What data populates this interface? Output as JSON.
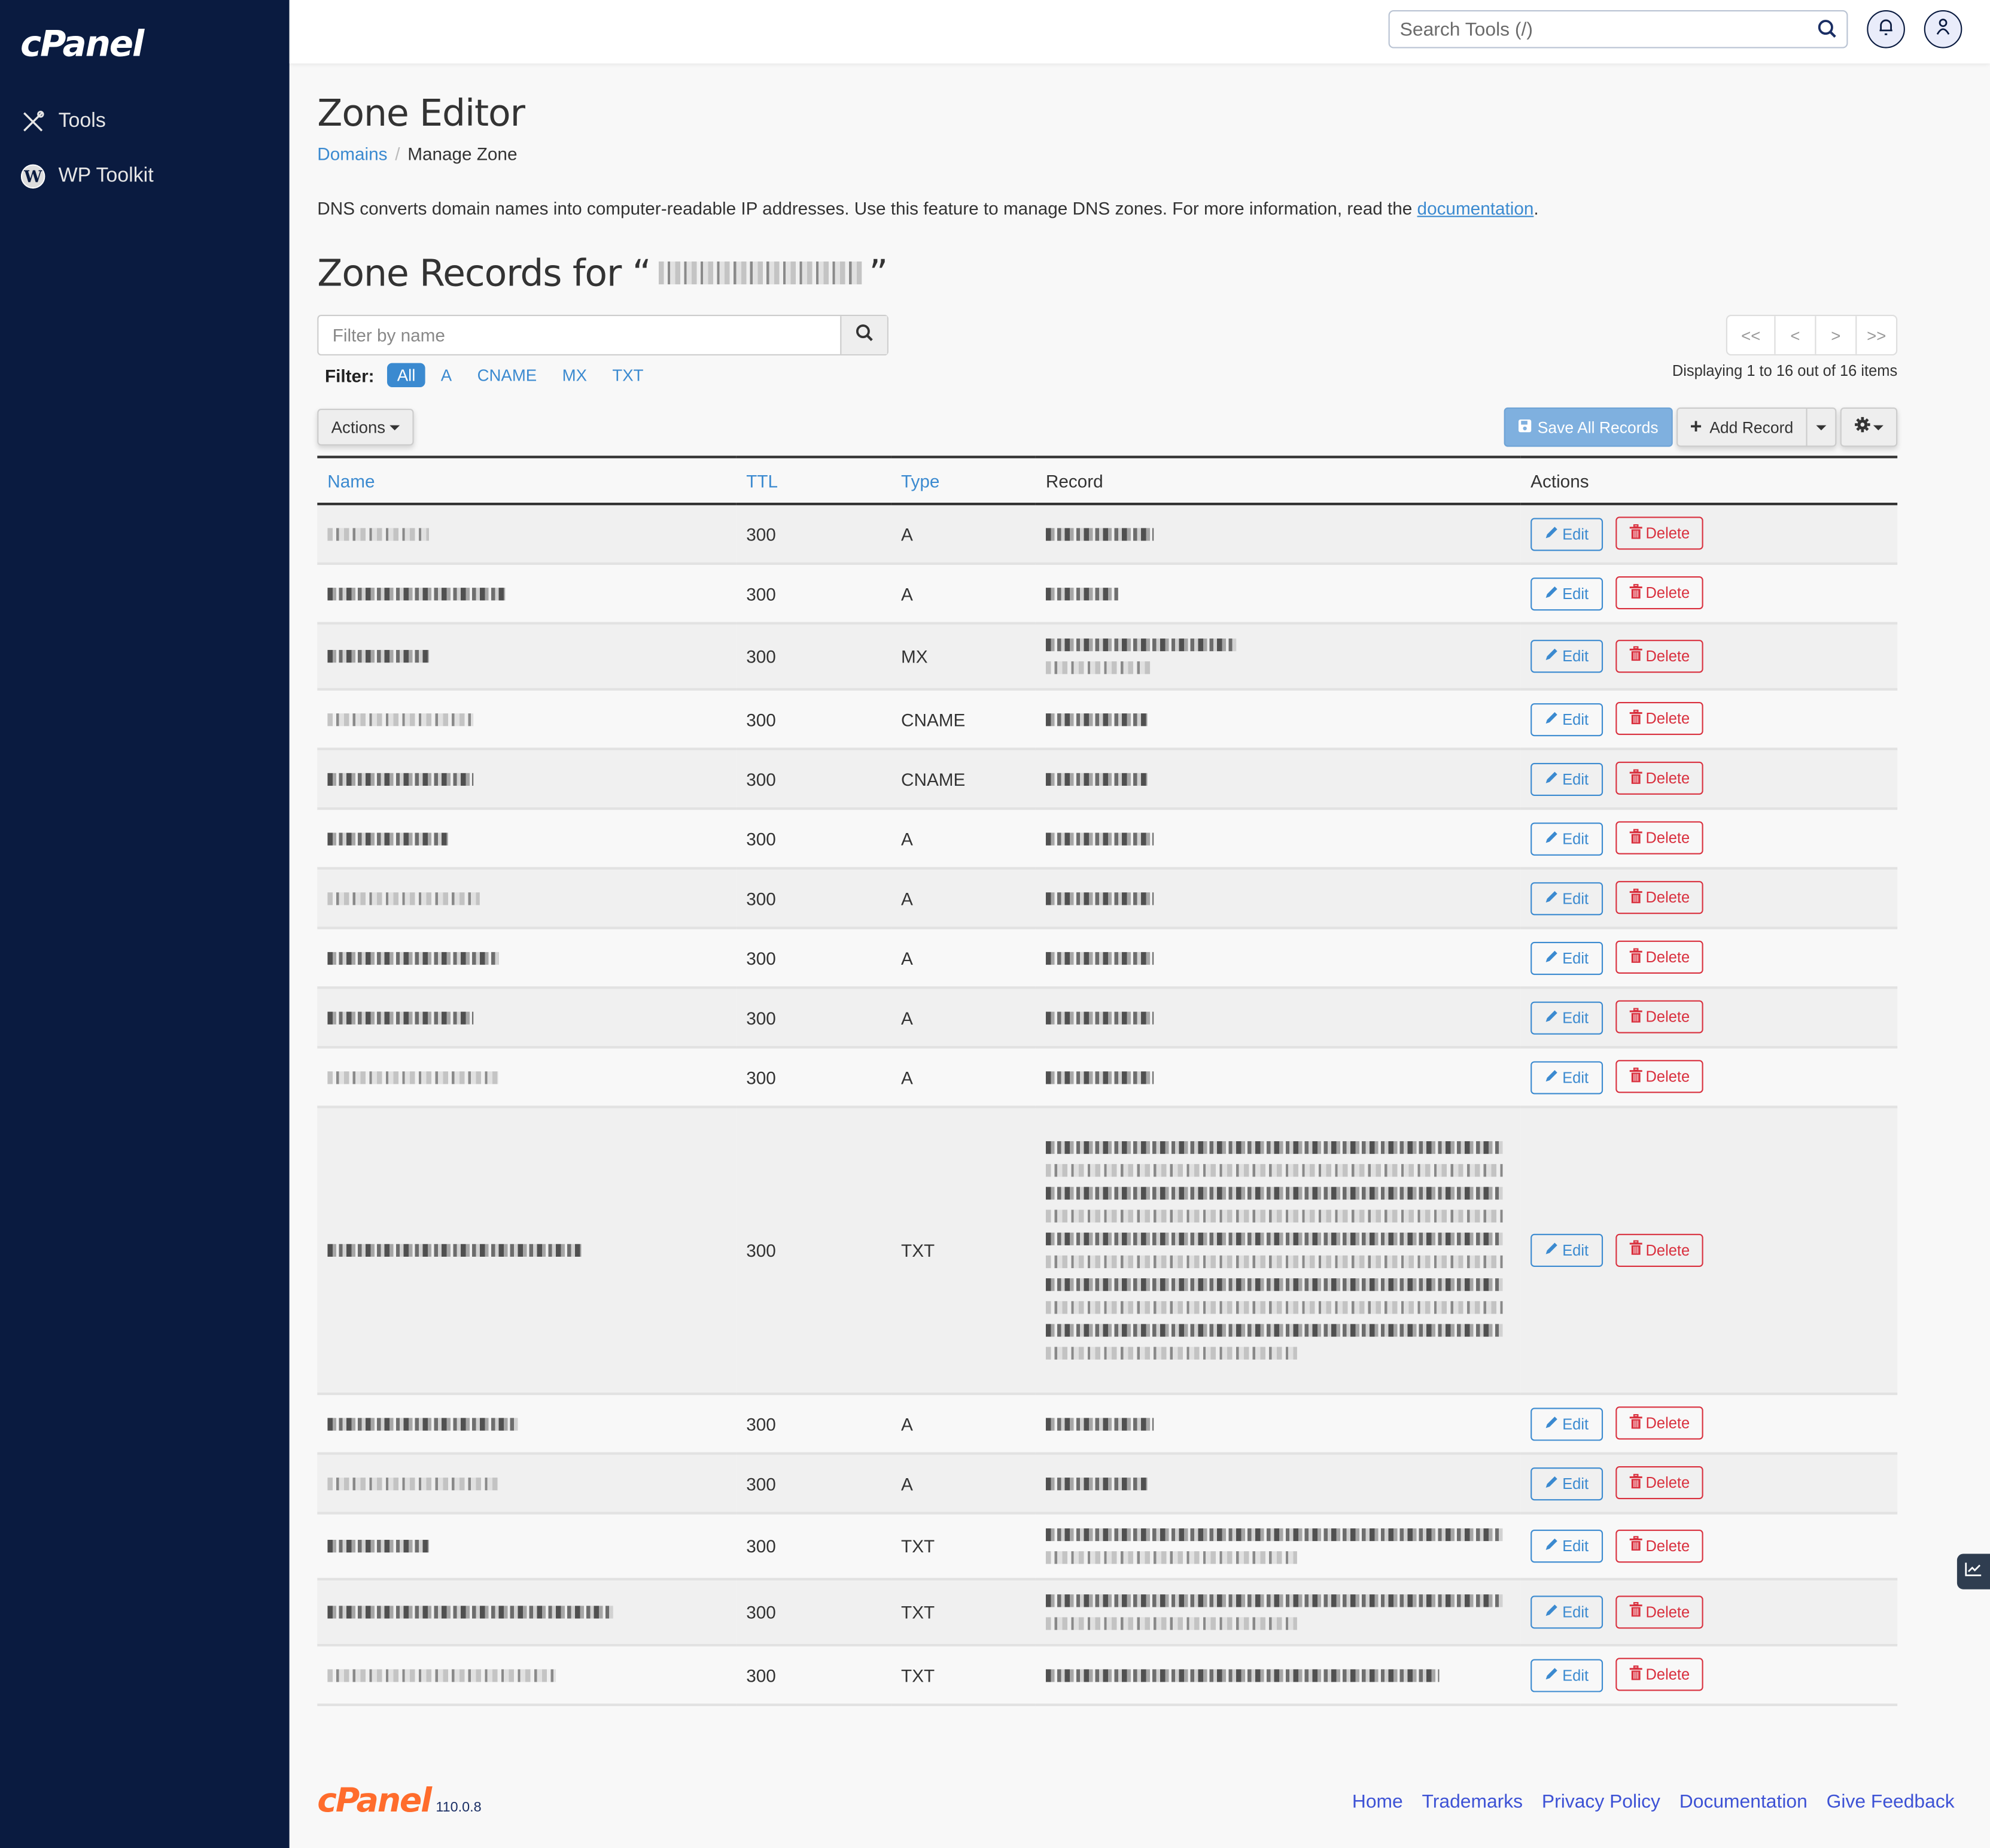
{
  "sidebar": {
    "logo": "cPanel",
    "items": [
      {
        "label": "Tools",
        "icon": "tools-icon"
      },
      {
        "label": "WP Toolkit",
        "icon": "wordpress-icon"
      }
    ]
  },
  "topbar": {
    "search_placeholder": "Search Tools (/)"
  },
  "page": {
    "title": "Zone Editor",
    "breadcrumb": [
      {
        "label": "Domains",
        "link": true
      },
      {
        "label": "Manage Zone",
        "link": false
      }
    ],
    "description_prefix": "DNS converts domain names into computer-readable IP addresses. Use this feature to manage DNS zones. For more information, read the ",
    "description_link": "documentation",
    "description_suffix": ".",
    "zone_heading_prefix": "Zone Records for “",
    "zone_heading_suffix": "”",
    "zone_domain": "[redacted]"
  },
  "filter": {
    "placeholder": "Filter by name",
    "label": "Filter:",
    "options": [
      "All",
      "A",
      "CNAME",
      "MX",
      "TXT"
    ],
    "active": "All"
  },
  "toolbar": {
    "actions_label": "Actions",
    "save_label": "Save All Records",
    "add_label": "Add Record"
  },
  "pagination": {
    "first": "<<",
    "prev": "<",
    "next": ">",
    "last": ">>",
    "display_text": "Displaying 1 to 16 out of 16 items"
  },
  "table": {
    "headers": {
      "name": "Name",
      "ttl": "TTL",
      "type": "Type",
      "record": "Record",
      "actions": "Actions"
    },
    "edit_label": "Edit",
    "delete_label": "Delete",
    "rows": [
      {
        "name": "[redacted]",
        "ttl": "300",
        "type": "A",
        "record_lines": 1
      },
      {
        "name": "[redacted]",
        "ttl": "300",
        "type": "A",
        "record_lines": 1
      },
      {
        "name": "[redacted]",
        "ttl": "300",
        "type": "MX",
        "record_lines": 2
      },
      {
        "name": "[redacted]",
        "ttl": "300",
        "type": "CNAME",
        "record_lines": 1
      },
      {
        "name": "[redacted]",
        "ttl": "300",
        "type": "CNAME",
        "record_lines": 1
      },
      {
        "name": "[redacted]",
        "ttl": "300",
        "type": "A",
        "record_lines": 1
      },
      {
        "name": "[redacted]",
        "ttl": "300",
        "type": "A",
        "record_lines": 1
      },
      {
        "name": "[redacted]",
        "ttl": "300",
        "type": "A",
        "record_lines": 1
      },
      {
        "name": "[redacted]",
        "ttl": "300",
        "type": "A",
        "record_lines": 1
      },
      {
        "name": "[redacted]",
        "ttl": "300",
        "type": "A",
        "record_lines": 1
      },
      {
        "name": "[redacted]",
        "ttl": "300",
        "type": "TXT",
        "record_lines": 10
      },
      {
        "name": "[redacted]",
        "ttl": "300",
        "type": "A",
        "record_lines": 1
      },
      {
        "name": "[redacted]",
        "ttl": "300",
        "type": "A",
        "record_lines": 1
      },
      {
        "name": "[redacted]",
        "ttl": "300",
        "type": "TXT",
        "record_lines": 2
      },
      {
        "name": "[redacted]",
        "ttl": "300",
        "type": "TXT",
        "record_lines": 2
      },
      {
        "name": "[redacted]",
        "ttl": "300",
        "type": "TXT",
        "record_lines": 1
      }
    ]
  },
  "footer": {
    "logo": "cPanel",
    "version": "110.0.8",
    "links": [
      "Home",
      "Trademarks",
      "Privacy Policy",
      "Documentation",
      "Give Feedback"
    ]
  },
  "colors": {
    "sidebar_bg": "#0a1b40",
    "accent": "#3b8ad0",
    "danger": "#d9303e",
    "brand_orange": "#ff6c2c",
    "footer_link": "#3d52d5"
  }
}
